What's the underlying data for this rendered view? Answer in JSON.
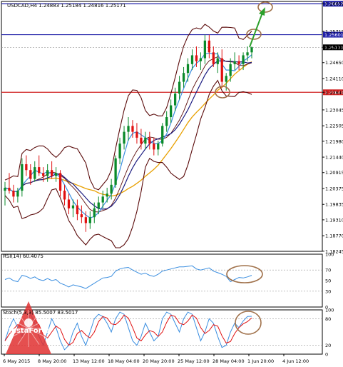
{
  "chart_data": {
    "type": "candlestick",
    "symbol_header": "USDCAD,H4  1.24883 1.25184 1.24816 1.25171",
    "price_axis": {
      "ticks": [
        "1.26652",
        "1.25715",
        "1.25171",
        "1.24650",
        "1.24110",
        "1.23643",
        "1.23045",
        "1.22505",
        "1.21980",
        "1.21440",
        "1.20915",
        "1.20375",
        "1.19835",
        "1.19310",
        "1.18770",
        "1.18245"
      ],
      "ylim": [
        1.1824,
        1.2673
      ]
    },
    "date_axis": {
      "ticks": [
        "6 May 2015",
        "8 May 20:00",
        "13 May 12:00",
        "18 May 04:00",
        "20 May 20:00",
        "25 May 12:00",
        "28 May 04:00",
        "1 Jun 20:00",
        "4 Jun 12:00"
      ]
    },
    "levels": [
      {
        "price": 1.26652,
        "label": "1.26652",
        "color": "#1f1fa8"
      },
      {
        "price": 1.25601,
        "label": "1.25601",
        "color": "#1f1fa8"
      },
      {
        "price": 1.23643,
        "label": "1.23643",
        "color": "#d02020"
      }
    ],
    "current_price": {
      "price": 1.25171,
      "label": "1.25171"
    },
    "candles": [
      [
        1.203,
        1.206,
        1.198,
        1.204
      ],
      [
        1.204,
        1.209,
        1.202,
        1.203
      ],
      [
        1.203,
        1.205,
        1.199,
        1.201
      ],
      [
        1.201,
        1.204,
        1.199,
        1.203
      ],
      [
        1.203,
        1.214,
        1.201,
        1.212
      ],
      [
        1.212,
        1.215,
        1.208,
        1.21
      ],
      [
        1.21,
        1.212,
        1.205,
        1.207
      ],
      [
        1.207,
        1.213,
        1.206,
        1.211
      ],
      [
        1.211,
        1.215,
        1.208,
        1.209
      ],
      [
        1.209,
        1.211,
        1.206,
        1.208
      ],
      [
        1.208,
        1.212,
        1.206,
        1.21
      ],
      [
        1.21,
        1.213,
        1.207,
        1.208
      ],
      [
        1.208,
        1.211,
        1.206,
        1.209
      ],
      [
        1.209,
        1.21,
        1.201,
        1.203
      ],
      [
        1.203,
        1.205,
        1.198,
        1.2
      ],
      [
        1.2,
        1.202,
        1.195,
        1.197
      ],
      [
        1.197,
        1.2,
        1.194,
        1.198
      ],
      [
        1.198,
        1.2,
        1.193,
        1.195
      ],
      [
        1.195,
        1.198,
        1.192,
        1.194
      ],
      [
        1.194,
        1.196,
        1.189,
        1.192
      ],
      [
        1.192,
        1.196,
        1.19,
        1.194
      ],
      [
        1.194,
        1.199,
        1.192,
        1.197
      ],
      [
        1.197,
        1.201,
        1.195,
        1.199
      ],
      [
        1.199,
        1.203,
        1.197,
        1.201
      ],
      [
        1.201,
        1.204,
        1.199,
        1.202
      ],
      [
        1.202,
        1.207,
        1.2,
        1.205
      ],
      [
        1.205,
        1.215,
        1.204,
        1.214
      ],
      [
        1.214,
        1.221,
        1.212,
        1.219
      ],
      [
        1.219,
        1.225,
        1.217,
        1.223
      ],
      [
        1.223,
        1.228,
        1.22,
        1.225
      ],
      [
        1.225,
        1.227,
        1.221,
        1.223
      ],
      [
        1.223,
        1.226,
        1.219,
        1.221
      ],
      [
        1.221,
        1.224,
        1.217,
        1.219
      ],
      [
        1.219,
        1.223,
        1.217,
        1.221
      ],
      [
        1.221,
        1.223,
        1.217,
        1.219
      ],
      [
        1.219,
        1.221,
        1.215,
        1.217
      ],
      [
        1.217,
        1.22,
        1.215,
        1.219
      ],
      [
        1.219,
        1.226,
        1.218,
        1.225
      ],
      [
        1.225,
        1.23,
        1.223,
        1.228
      ],
      [
        1.228,
        1.234,
        1.226,
        1.232
      ],
      [
        1.232,
        1.238,
        1.23,
        1.236
      ],
      [
        1.236,
        1.242,
        1.234,
        1.24
      ],
      [
        1.24,
        1.245,
        1.238,
        1.243
      ],
      [
        1.243,
        1.248,
        1.24,
        1.246
      ],
      [
        1.246,
        1.251,
        1.244,
        1.249
      ],
      [
        1.249,
        1.252,
        1.245,
        1.247
      ],
      [
        1.247,
        1.25,
        1.244,
        1.248
      ],
      [
        1.248,
        1.256,
        1.246,
        1.254
      ],
      [
        1.254,
        1.256,
        1.248,
        1.25
      ],
      [
        1.25,
        1.252,
        1.245,
        1.246
      ],
      [
        1.246,
        1.25,
        1.243,
        1.248
      ],
      [
        1.248,
        1.251,
        1.238,
        1.24
      ],
      [
        1.24,
        1.243,
        1.237,
        1.242
      ],
      [
        1.242,
        1.248,
        1.24,
        1.246
      ],
      [
        1.246,
        1.25,
        1.244,
        1.247
      ],
      [
        1.247,
        1.249,
        1.244,
        1.246
      ],
      [
        1.246,
        1.25,
        1.244,
        1.249
      ],
      [
        1.249,
        1.252,
        1.247,
        1.25
      ],
      [
        1.25,
        1.252,
        1.248,
        1.2517
      ]
    ],
    "indicators": {
      "rsi": {
        "label": "RSI(14) 60.4075",
        "ticks": [
          "100",
          "70",
          "50",
          "30",
          "0"
        ],
        "ylim": [
          0,
          100
        ],
        "values": [
          52,
          55,
          50,
          48,
          60,
          58,
          54,
          57,
          52,
          50,
          54,
          50,
          52,
          45,
          42,
          38,
          42,
          40,
          38,
          35,
          40,
          45,
          50,
          55,
          56,
          58,
          68,
          72,
          74,
          75,
          70,
          66,
          62,
          64,
          60,
          58,
          62,
          68,
          70,
          72,
          74,
          76,
          76,
          77,
          78,
          72,
          70,
          72,
          74,
          68,
          65,
          62,
          58,
          48,
          52,
          56,
          55,
          57,
          60
        ]
      },
      "stochastic": {
        "label": "Stoch(5,3,3) 85.5007 83.5017",
        "ticks": [
          "100",
          "80",
          "20",
          "0"
        ],
        "ylim": [
          0,
          100
        ],
        "main": [
          30,
          60,
          80,
          60,
          40,
          70,
          90,
          70,
          40,
          20,
          50,
          80,
          60,
          30,
          10,
          20,
          50,
          70,
          40,
          20,
          50,
          80,
          90,
          85,
          70,
          50,
          80,
          95,
          90,
          60,
          30,
          20,
          40,
          70,
          50,
          30,
          40,
          80,
          95,
          90,
          70,
          50,
          80,
          95,
          90,
          60,
          30,
          50,
          80,
          70,
          40,
          15,
          20,
          50,
          70,
          60,
          75,
          85,
          85.5
        ]
      }
    }
  },
  "branding": {
    "logo_text": "InstaForex"
  }
}
